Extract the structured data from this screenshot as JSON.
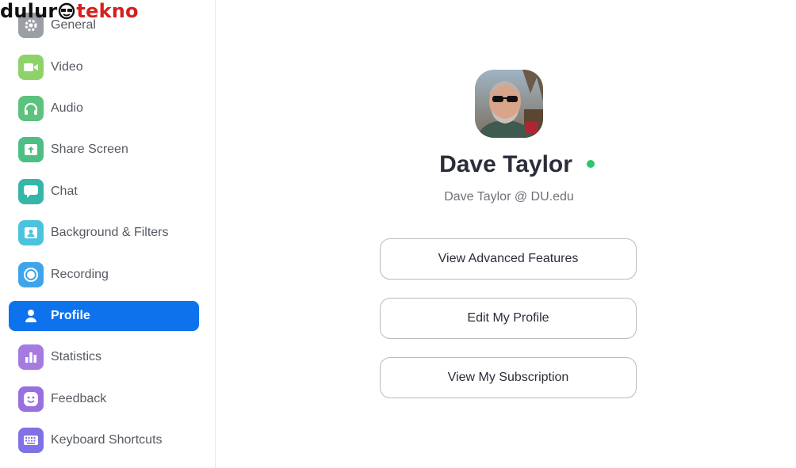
{
  "watermark": {
    "part1": "dulur",
    "part2": "tekno"
  },
  "sidebar": {
    "items": [
      {
        "label": "General",
        "icon": "gear-icon",
        "color": "#9a9ea5"
      },
      {
        "label": "Video",
        "icon": "video-camera-icon",
        "color": "#8fd26a"
      },
      {
        "label": "Audio",
        "icon": "headphones-icon",
        "color": "#5cc27e"
      },
      {
        "label": "Share Screen",
        "icon": "share-screen-icon",
        "color": "#4dbf85"
      },
      {
        "label": "Chat",
        "icon": "chat-bubble-icon",
        "color": "#36b6a9"
      },
      {
        "label": "Background & Filters",
        "icon": "person-portrait-icon",
        "color": "#4cc3dd"
      },
      {
        "label": "Recording",
        "icon": "record-icon",
        "color": "#3fa5ea"
      },
      {
        "label": "Profile",
        "icon": "person-icon",
        "color": "#0e72ed"
      },
      {
        "label": "Statistics",
        "icon": "bar-chart-icon",
        "color": "#a57be0"
      },
      {
        "label": "Feedback",
        "icon": "smiley-icon",
        "color": "#9a6fe0"
      },
      {
        "label": "Keyboard Shortcuts",
        "icon": "keyboard-icon",
        "color": "#7f72e6"
      }
    ],
    "active_index": 7
  },
  "profile": {
    "name": "Dave Taylor",
    "status": "online",
    "status_color": "#2bc86b",
    "email": "Dave Taylor @ DU.edu"
  },
  "buttons": {
    "advanced": "View Advanced Features",
    "edit": "Edit My Profile",
    "subscription": "View My Subscription"
  }
}
